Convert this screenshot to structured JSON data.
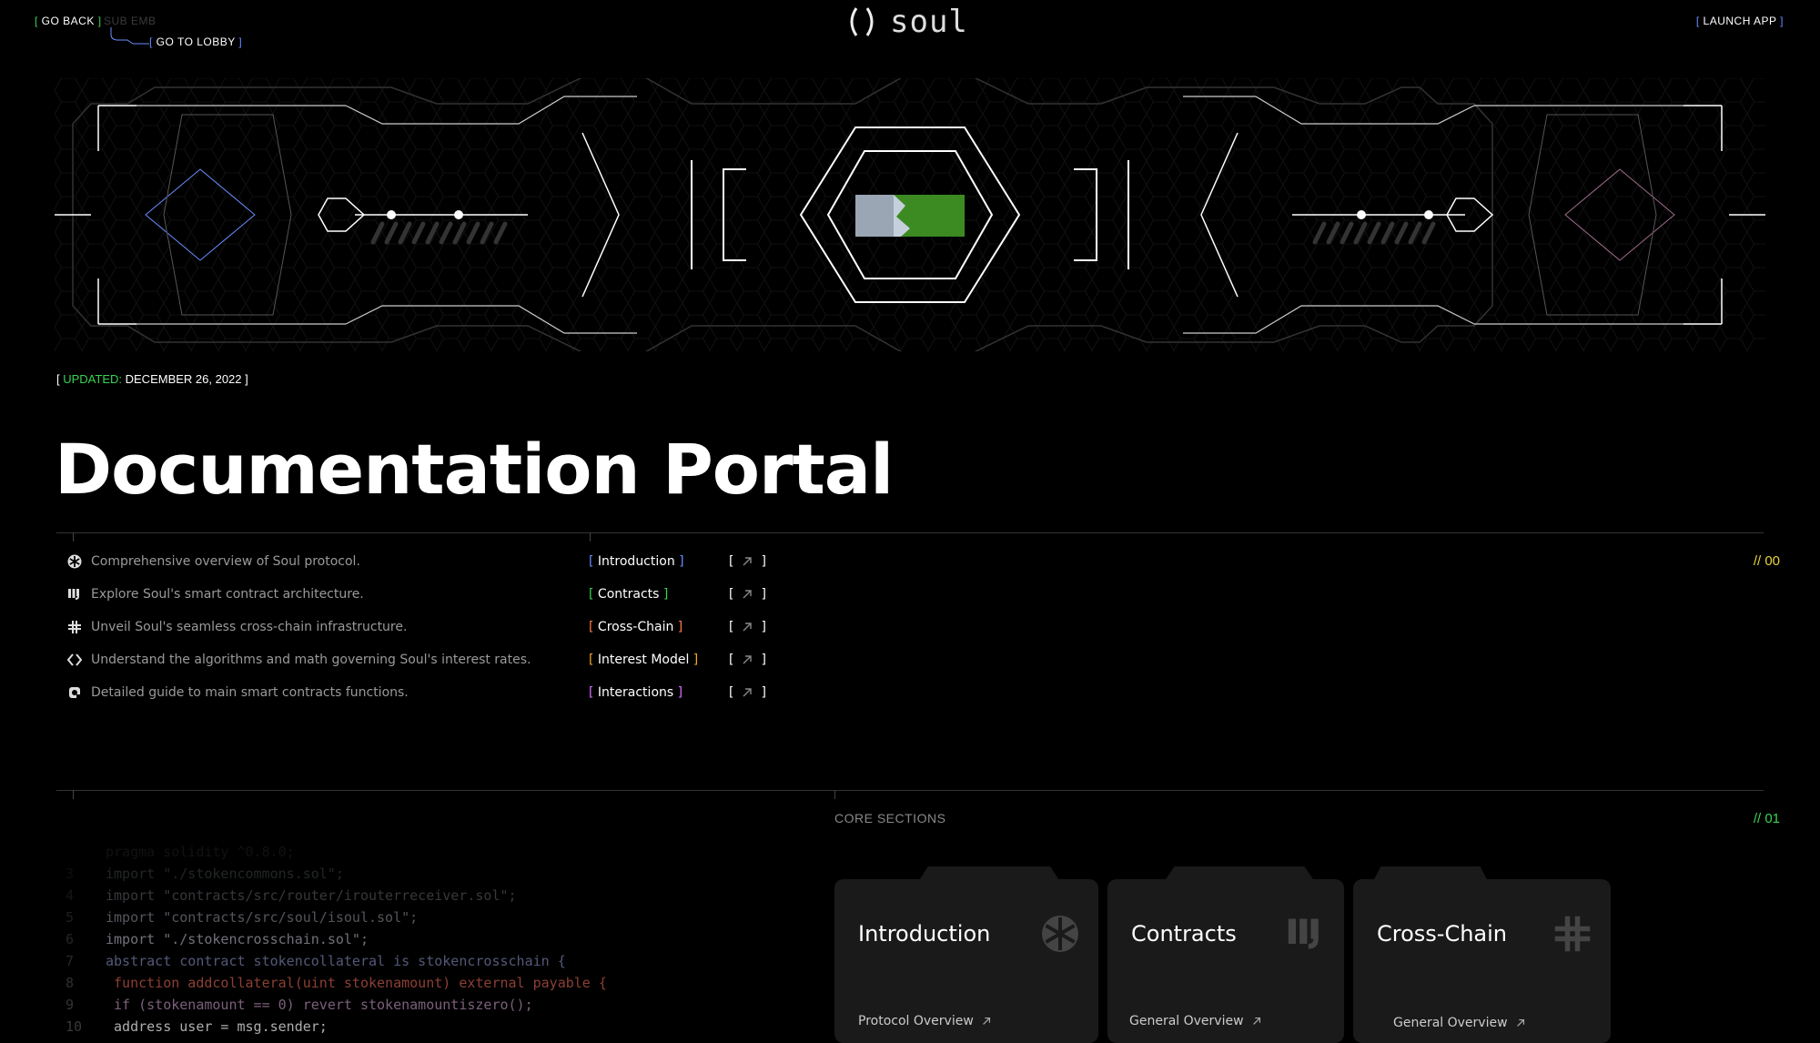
{
  "nav": {
    "go_back": "GO BACK",
    "sub_ghost": "SUB EMB",
    "go_lobby": "GO TO LOBBY",
    "launch_app": "LAUNCH APP"
  },
  "logo": {
    "text": "soul"
  },
  "updated": {
    "label": "UPDATED:",
    "date": "DECEMBER 26, 2022"
  },
  "page_title": "Documentation Portal",
  "index_number": "// 00",
  "docs": [
    {
      "icon": "asterisk-icon",
      "description": "Comprehensive overview of Soul  protocol.",
      "link": "Introduction",
      "color": "#6b8cff"
    },
    {
      "icon": "bars-icon",
      "description": "Explore Soul's smart contract architecture.",
      "link": "Contracts",
      "color": "#39d353"
    },
    {
      "icon": "grid-cross-icon",
      "description": "Unveil Soul's seamless cross-chain infrastructure.",
      "link": "Cross-Chain",
      "color": "#ff7a45"
    },
    {
      "icon": "diamond-icon",
      "description": "Understand the algorithms and math governing Soul's interest rates.",
      "link": "Interest Model",
      "color": "#f5a623"
    },
    {
      "icon": "gear-icon",
      "description": "Detailed guide to main smart contracts functions.",
      "link": "Interactions",
      "color": "#d96bff"
    }
  ],
  "core": {
    "label": "CORE SECTIONS",
    "number": "// 01",
    "cards": [
      {
        "title": "Introduction",
        "link": "Protocol Overview"
      },
      {
        "title": "Contracts",
        "link": "General Overview"
      },
      {
        "title": "Cross-Chain",
        "link": "General Overview"
      }
    ]
  },
  "code_lines": [
    {
      "n": "",
      "text": "pragma solidity ^0.8.0;"
    },
    {
      "n": "3",
      "text": "import \"./stokencommons.sol\";"
    },
    {
      "n": "4",
      "text": "import \"contracts/src/router/irouterreceiver.sol\";"
    },
    {
      "n": "5",
      "text": "import \"contracts/src/soul/isoul.sol\";"
    },
    {
      "n": "6",
      "text": "import \"./stokencrosschain.sol\";"
    },
    {
      "n": "7",
      "text": "abstract contract stokencollateral is stokencrosschain {"
    },
    {
      "n": "8",
      "text": "    function addcollateral(uint stokenamount) external payable {"
    },
    {
      "n": "9",
      "text": "    if (stokenamount == 0) revert stokenamountiszero();"
    },
    {
      "n": "10",
      "text": "    address user = msg.sender;"
    }
  ],
  "colors": {
    "accent_green": "#39d353",
    "accent_yellow": "#e6d33a",
    "accent_blue": "#6b8cff",
    "background": "#000000",
    "card_bg": "#1a1a1a"
  }
}
